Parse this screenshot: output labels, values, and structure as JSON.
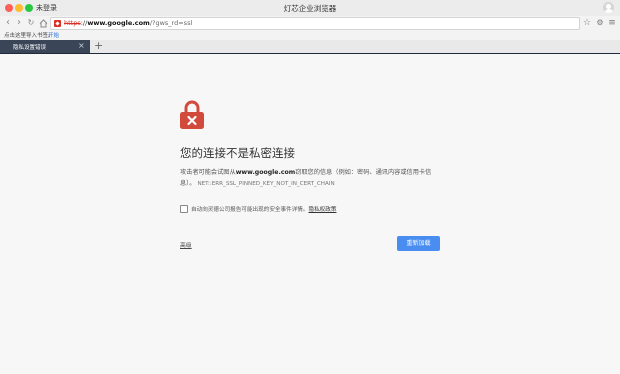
{
  "window": {
    "user_label": "未登录",
    "app_title": "灯芯企业浏览器"
  },
  "address_bar": {
    "scheme": "https",
    "separator": "://",
    "host": "www.google.com",
    "path": "/?gws_rd=ssl"
  },
  "bookmarks_bar": {
    "prompt": "点击这里导入书签。",
    "link": "开始"
  },
  "tabs": [
    {
      "label": "隐私设置错误"
    }
  ],
  "icons": {
    "back": "back-arrow-icon",
    "forward": "forward-arrow-icon",
    "reload": "reload-icon",
    "home": "home-icon",
    "star": "bookmark-star-icon",
    "tools": "wrench-icon",
    "menu": "menu-icon",
    "warning": "broken-lock-icon",
    "padlock": "padlock-x-icon"
  },
  "colors": {
    "accent": "#4a8df0",
    "danger": "#d93025",
    "padlock": "#d24a3b",
    "tab_active": "#3a4658"
  },
  "interstitial": {
    "heading": "您的连接不是私密连接",
    "desc_prefix": "攻击者可能会试图从",
    "desc_host": "www.google.com",
    "desc_suffix": "窃取您的信息（例如：密码、通讯内容或信用卡信息）。",
    "error_code": "NET::ERR_SSL_PINNED_KEY_NOT_IN_CERT_CHAIN",
    "checkbox_label": "自动向灵德公司报告可能出现的安全事件详情。",
    "checkbox_link": "隐私权政策",
    "advanced_label": "高级",
    "reload_label": "重新加载"
  }
}
